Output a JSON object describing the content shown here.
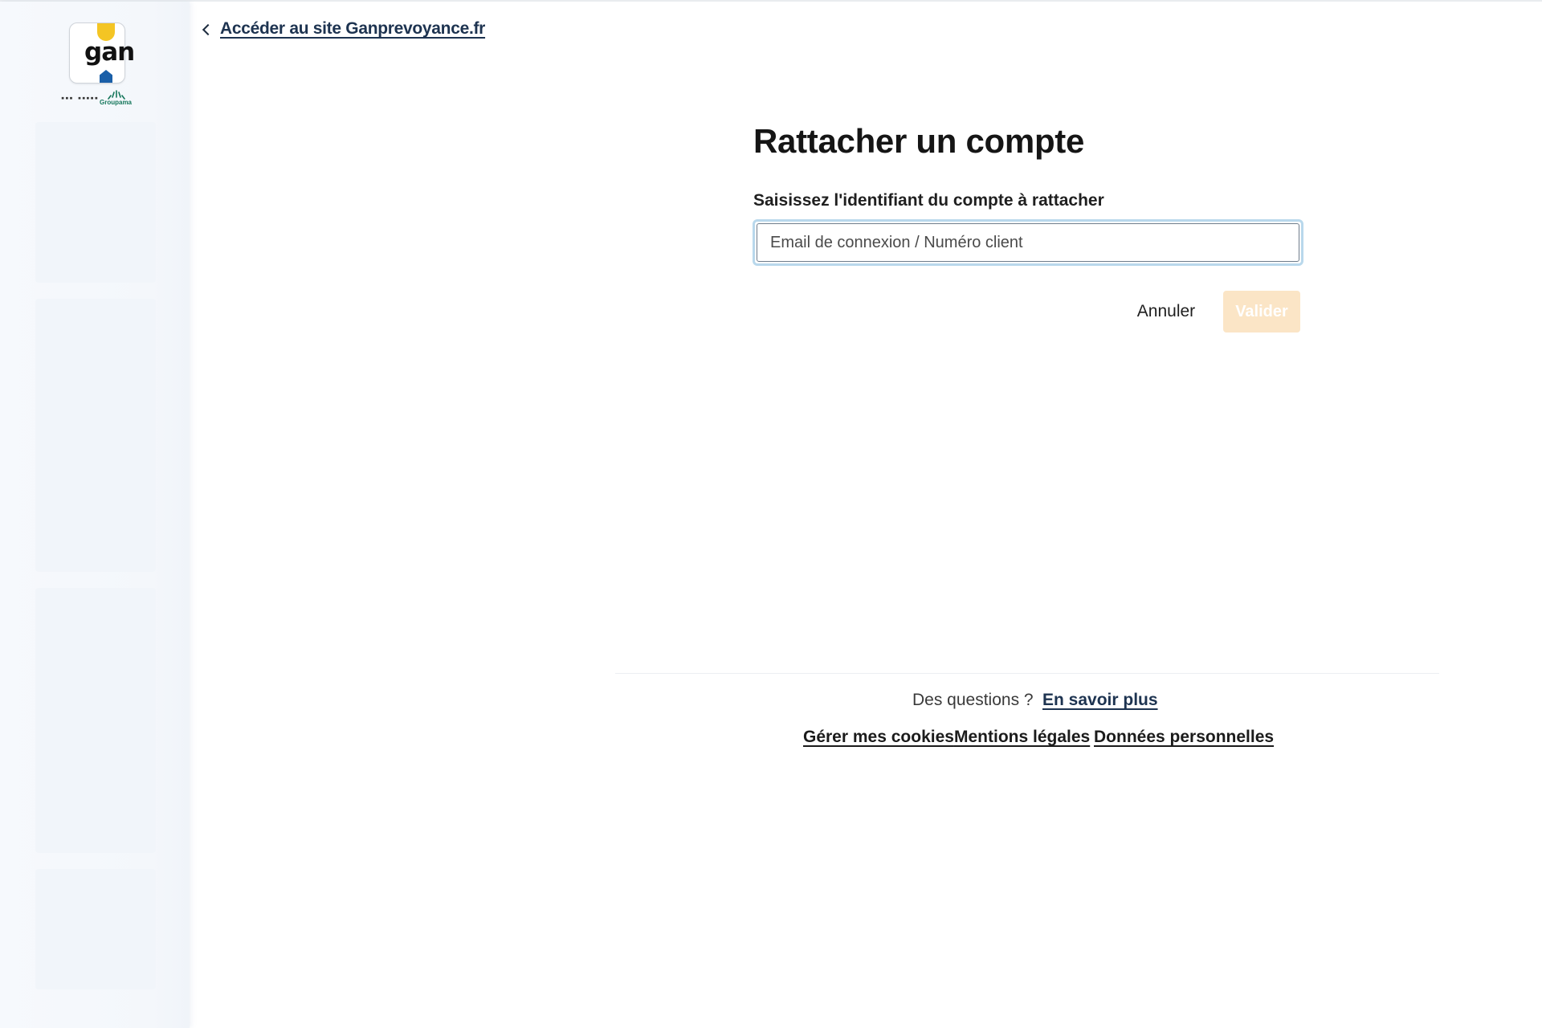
{
  "header": {
    "back_link_label": "Accéder au site Ganprevoyance.fr"
  },
  "logo": {
    "brand": "gan",
    "group": "Groupama"
  },
  "main": {
    "title": "Rattacher un compte",
    "field_label": "Saisissez l'identifiant du compte à rattacher",
    "field_placeholder": "Email de connexion / Numéro client",
    "field_value": "",
    "cancel_label": "Annuler",
    "submit_label": "Valider",
    "submit_disabled": true
  },
  "footer": {
    "question_text": "Des questions ?",
    "learn_more_label": "En savoir plus",
    "links": [
      {
        "label": "Gérer mes cookies"
      },
      {
        "label": "Mentions légales"
      },
      {
        "label": "Données personnelles"
      }
    ]
  },
  "colors": {
    "link_navy": "#1d3350",
    "submit_disabled_bg": "#fbe5c6",
    "input_focus_ring": "#b9d8ec",
    "logo_yellow": "#f4c524",
    "logo_blue": "#1a5fa8"
  }
}
